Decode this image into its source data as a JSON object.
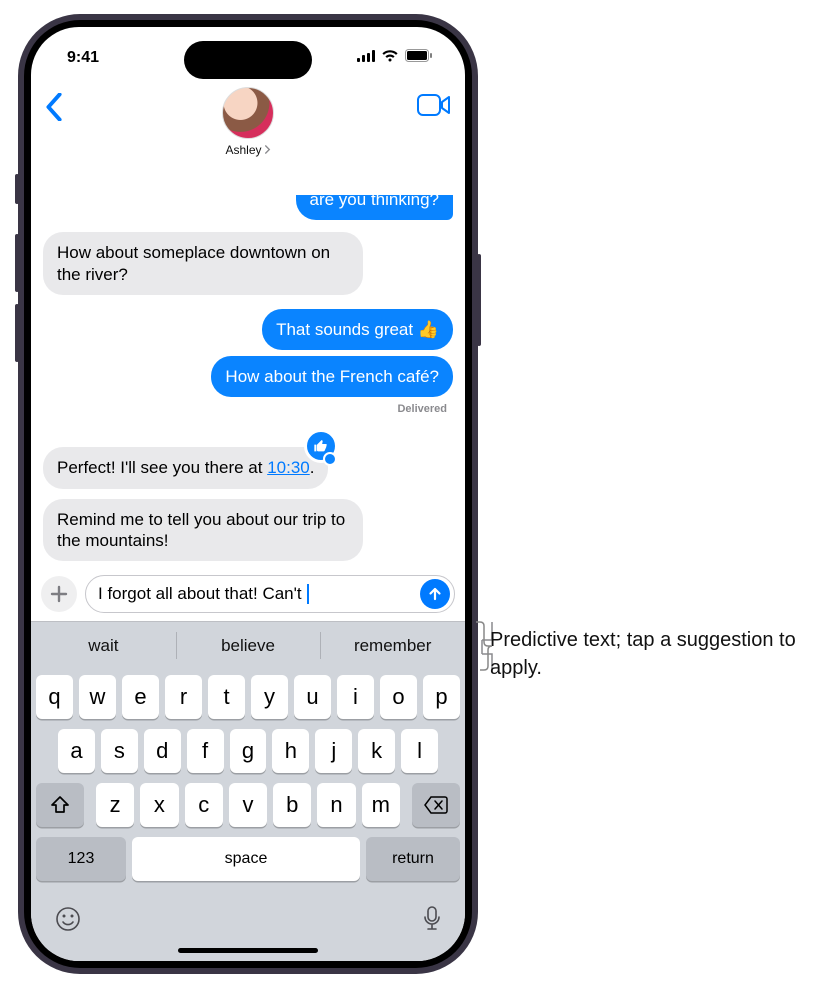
{
  "status": {
    "time": "9:41"
  },
  "nav": {
    "contact_name": "Ashley"
  },
  "messages": [
    {
      "id": "m0",
      "side": "sent",
      "text": "are you thinking?",
      "clipped": true
    },
    {
      "id": "m1",
      "side": "recv",
      "text": "How about someplace downtown on the river?"
    },
    {
      "id": "m2",
      "side": "sent",
      "text": "That sounds great 👍"
    },
    {
      "id": "m3",
      "side": "sent",
      "text": "How about the French café?"
    }
  ],
  "delivered_label": "Delivered",
  "message_tapback": {
    "text_pre": "Perfect! I'll see you there at ",
    "time": "10:30",
    "text_post": "."
  },
  "message_last_recv": "Remind me to tell you about our trip to the mountains!",
  "compose": {
    "text": "I forgot all about that! Can't "
  },
  "predictive": [
    "wait",
    "believe",
    "remember"
  ],
  "keyboard": {
    "row1": [
      "q",
      "w",
      "e",
      "r",
      "t",
      "y",
      "u",
      "i",
      "o",
      "p"
    ],
    "row2": [
      "a",
      "s",
      "d",
      "f",
      "g",
      "h",
      "j",
      "k",
      "l"
    ],
    "row3": [
      "z",
      "x",
      "c",
      "v",
      "b",
      "n",
      "m"
    ],
    "label_123": "123",
    "label_space": "space",
    "label_return": "return"
  },
  "callout": "Predictive text; tap a suggestion to apply."
}
